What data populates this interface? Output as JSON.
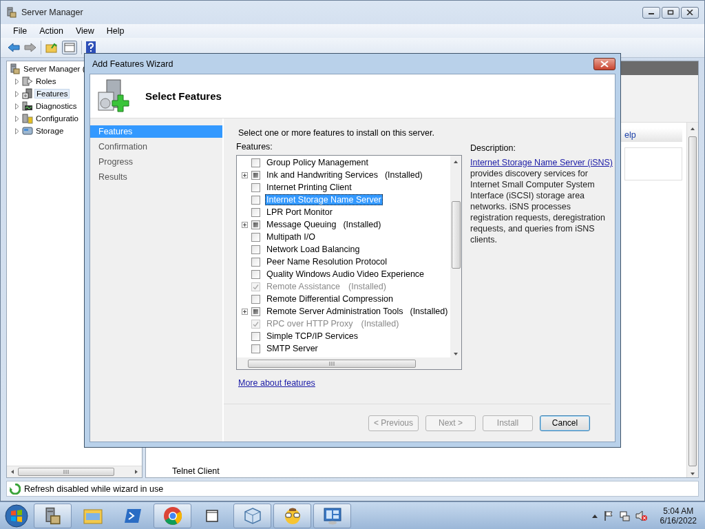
{
  "window": {
    "title": "Server Manager"
  },
  "menu": [
    "File",
    "Action",
    "View",
    "Help"
  ],
  "tree": {
    "label": "Server Manager (",
    "children": [
      {
        "label": "Roles",
        "kind": "roles",
        "expanded": false,
        "selected": false
      },
      {
        "label": "Features",
        "kind": "features",
        "expanded": false,
        "selected": true
      },
      {
        "label": "Diagnostics",
        "kind": "diagnostics",
        "expanded": false,
        "selected": false
      },
      {
        "label": "Configuratio",
        "kind": "configuration",
        "expanded": false,
        "selected": false
      },
      {
        "label": "Storage",
        "kind": "storage",
        "expanded": false,
        "selected": false
      }
    ]
  },
  "right_pane": {
    "link_fragment": "elp",
    "item": "Telnet Client"
  },
  "status_bar": "Refresh disabled while wizard in use",
  "dialog": {
    "title": "Add Features Wizard",
    "heading": "Select Features",
    "steps": [
      {
        "label": "Features",
        "selected": true
      },
      {
        "label": "Confirmation",
        "selected": false
      },
      {
        "label": "Progress",
        "selected": false
      },
      {
        "label": "Results",
        "selected": false
      }
    ],
    "instruction": "Select one or more features to install on this server.",
    "features_label": "Features:",
    "features": [
      {
        "label": "Group Policy Management",
        "checked": false,
        "partial": false,
        "disabled": false,
        "selected": false
      },
      {
        "label": "Ink and Handwriting Services",
        "note": "(Installed)",
        "checked": false,
        "partial": true,
        "disabled": false,
        "expanded": false,
        "selected": false
      },
      {
        "label": "Internet Printing Client",
        "checked": false,
        "partial": false,
        "disabled": false,
        "selected": false
      },
      {
        "label": "Internet Storage Name Server",
        "checked": false,
        "partial": false,
        "disabled": false,
        "selected": true
      },
      {
        "label": "LPR Port Monitor",
        "checked": false,
        "partial": false,
        "disabled": false,
        "selected": false
      },
      {
        "label": "Message Queuing",
        "note": "(Installed)",
        "checked": false,
        "partial": true,
        "disabled": false,
        "expanded": false,
        "selected": false
      },
      {
        "label": "Multipath I/O",
        "checked": false,
        "partial": false,
        "disabled": false,
        "selected": false
      },
      {
        "label": "Network Load Balancing",
        "checked": false,
        "partial": false,
        "disabled": false,
        "selected": false
      },
      {
        "label": "Peer Name Resolution Protocol",
        "checked": false,
        "partial": false,
        "disabled": false,
        "selected": false
      },
      {
        "label": "Quality Windows Audio Video Experience",
        "checked": false,
        "partial": false,
        "disabled": false,
        "selected": false
      },
      {
        "label": "Remote Assistance",
        "note": "(Installed)",
        "checked": true,
        "disabled": true,
        "selected": false
      },
      {
        "label": "Remote Differential Compression",
        "checked": false,
        "partial": false,
        "disabled": false,
        "selected": false
      },
      {
        "label": "Remote Server Administration Tools",
        "note": "(Installed)",
        "checked": false,
        "partial": true,
        "disabled": false,
        "expanded": false,
        "selected": false
      },
      {
        "label": "RPC over HTTP Proxy",
        "note": "(Installed)",
        "checked": true,
        "disabled": true,
        "selected": false
      },
      {
        "label": "Simple TCP/IP Services",
        "checked": false,
        "partial": false,
        "disabled": false,
        "selected": false
      },
      {
        "label": "SMTP Server",
        "checked": false,
        "partial": false,
        "disabled": false,
        "selected": false
      }
    ],
    "description_label": "Description:",
    "description": {
      "link": "Internet Storage Name Server (iSNS)",
      "text": " provides discovery services for Internet Small Computer System Interface (iSCSI) storage area networks. iSNS processes registration requests, deregistration requests, and queries from iSNS clients."
    },
    "more_link": "More about features",
    "buttons": [
      {
        "label": "< Previous",
        "disabled": true,
        "default": false
      },
      {
        "label": "Next >",
        "disabled": true,
        "default": false
      },
      {
        "label": "Install",
        "disabled": true,
        "default": false
      },
      {
        "label": "Cancel",
        "disabled": false,
        "default": true
      }
    ]
  },
  "taskbar": {
    "apps": [
      {
        "kind": "server",
        "running": true
      },
      {
        "kind": "explorer",
        "running": false
      },
      {
        "kind": "powershell",
        "running": false
      },
      {
        "kind": "chrome",
        "running": true
      },
      {
        "kind": "folder",
        "running": false
      },
      {
        "kind": "box",
        "running": true
      },
      {
        "kind": "face",
        "running": true
      },
      {
        "kind": "panel",
        "running": true
      }
    ],
    "clock": {
      "time": "5:04 AM",
      "date": "6/16/2022"
    }
  }
}
